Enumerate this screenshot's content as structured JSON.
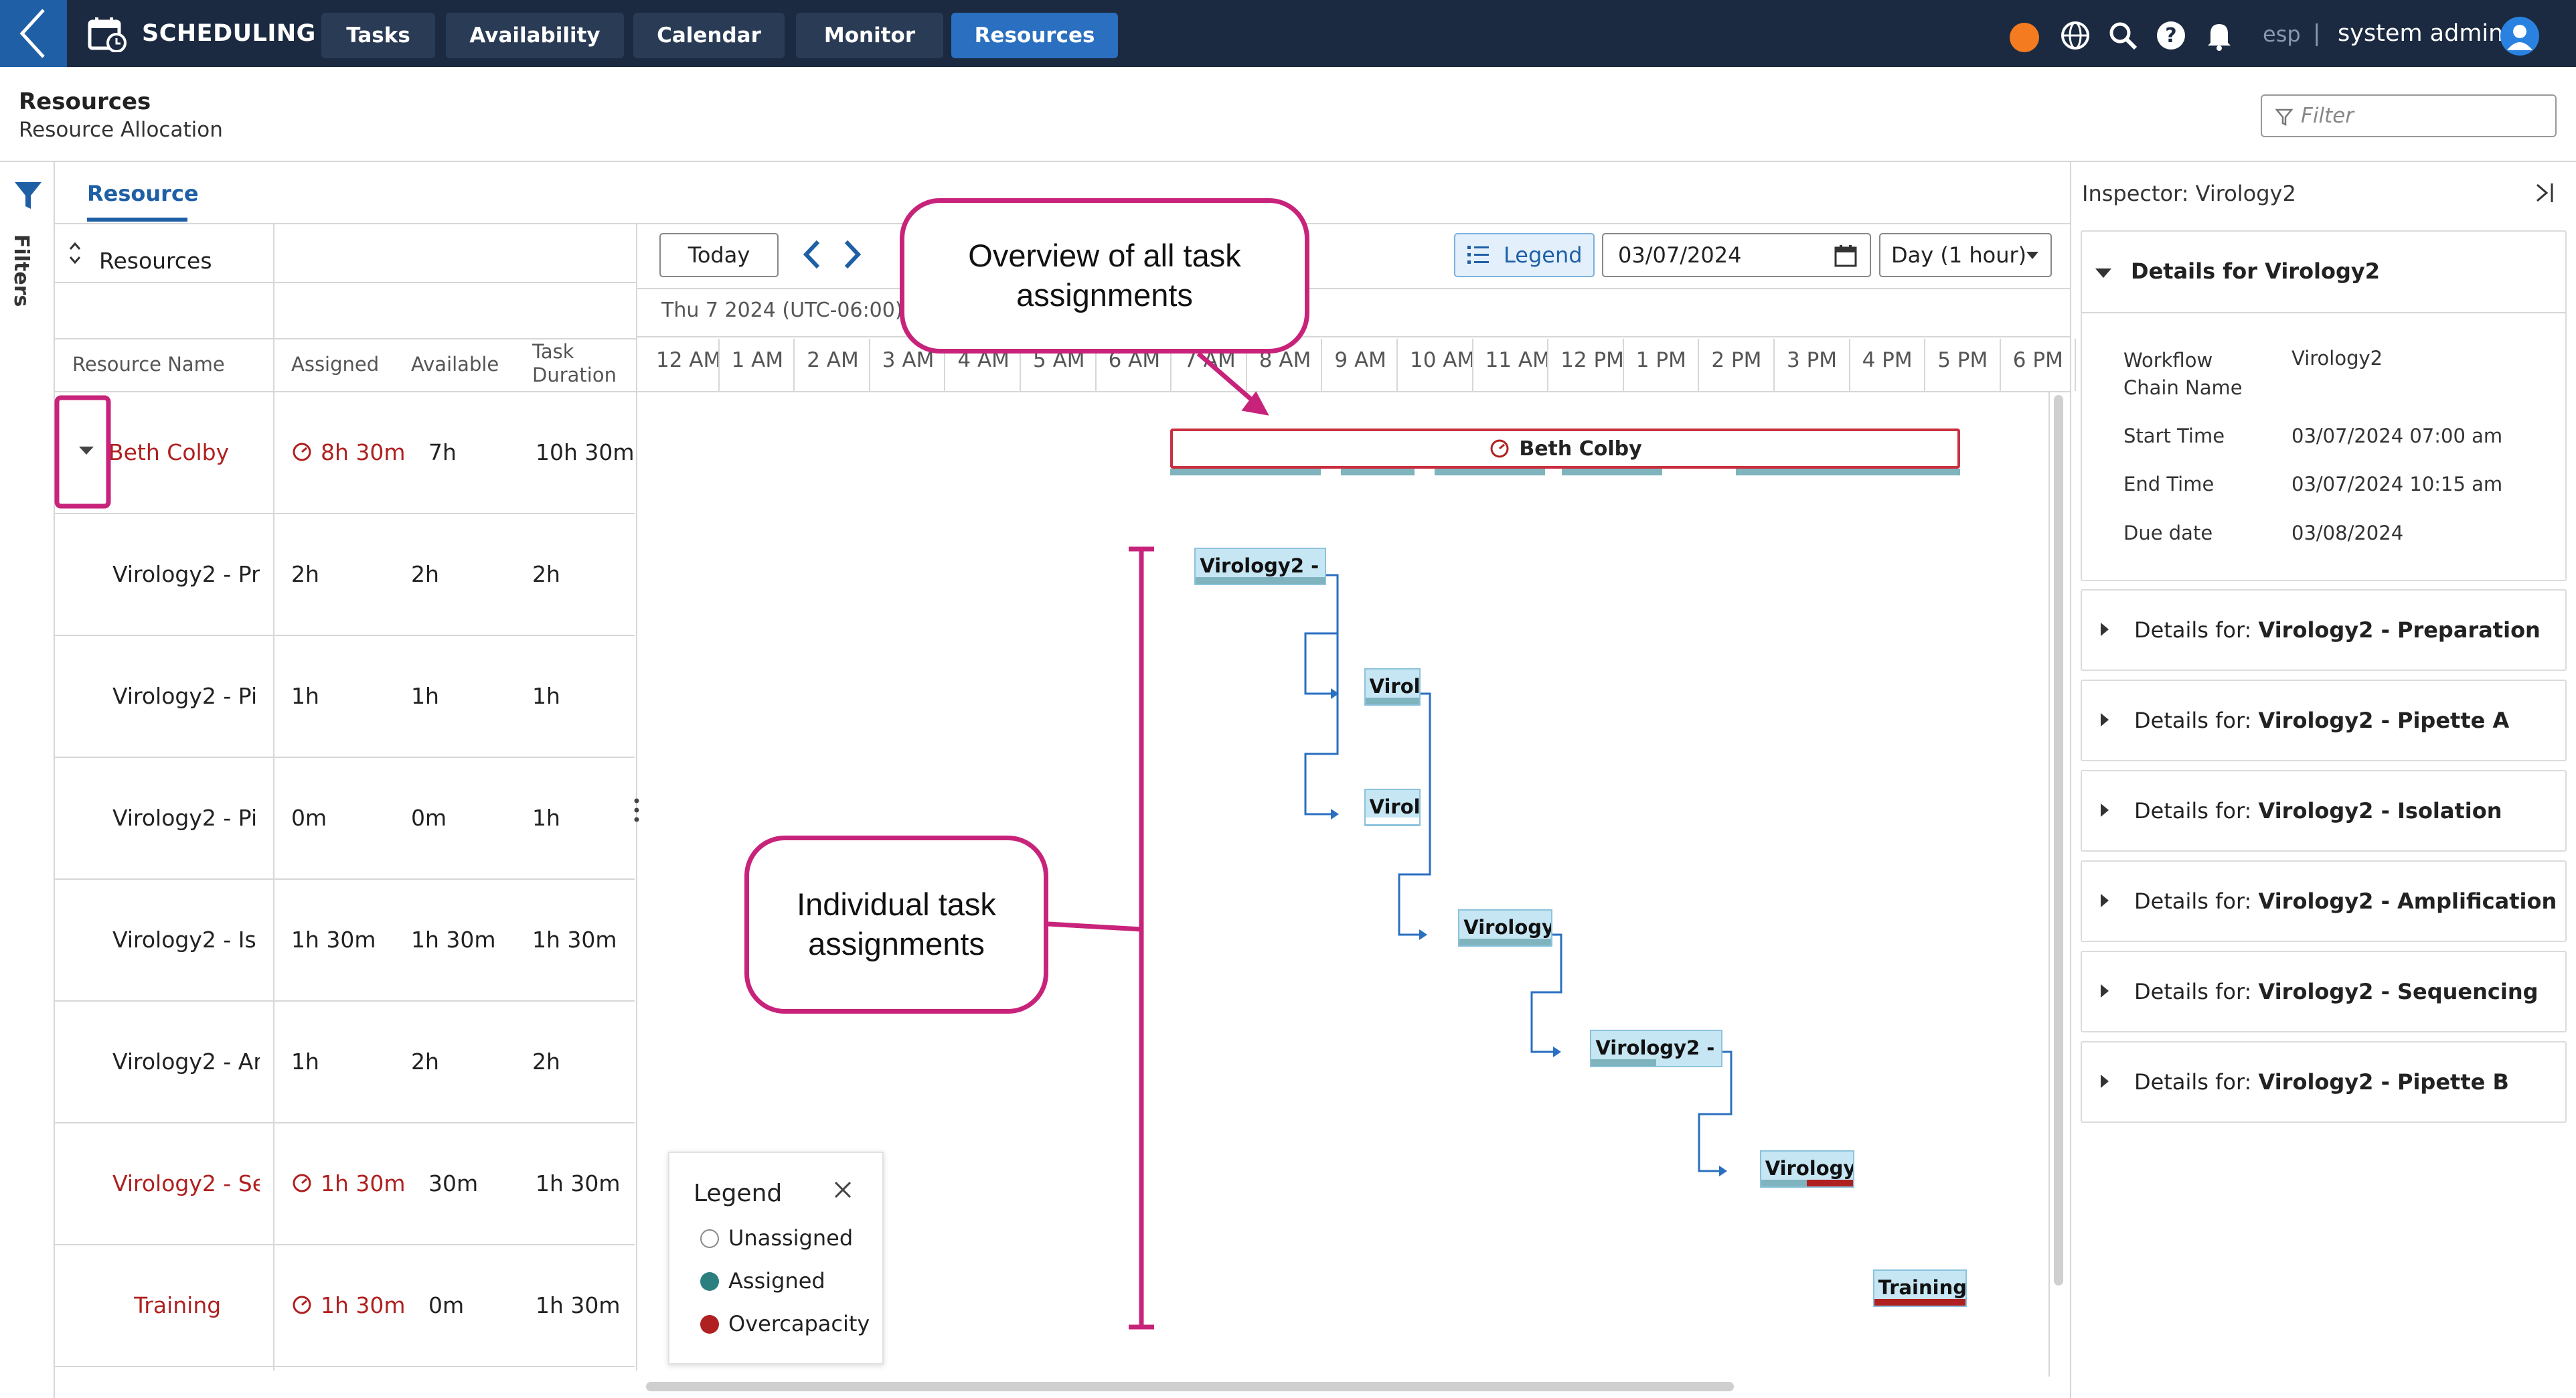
{
  "app": {
    "title": "SCHEDULING"
  },
  "nav": {
    "tabs": [
      "Tasks",
      "Availability",
      "Calendar",
      "Monitor",
      "Resources"
    ],
    "active": "Resources"
  },
  "topbar": {
    "lang": "esp",
    "user": "system admin"
  },
  "page": {
    "title": "Resources",
    "subtitle": "Resource Allocation",
    "filter_placeholder": "Filter"
  },
  "filters_label": "Filters",
  "resource_tab": "Resource",
  "table": {
    "group_header": "Resources",
    "columns": [
      "Resource Name",
      "Assigned",
      "Available",
      "Task\nDuration"
    ],
    "rows": [
      {
        "name": "Beth Colby",
        "assigned": "8h 30m",
        "available": "7h",
        "duration": "10h 30m",
        "over": true
      },
      {
        "name": "Virology2 - Pr",
        "assigned": "2h",
        "available": "2h",
        "duration": "2h",
        "over": false
      },
      {
        "name": "Virology2 - Pi",
        "assigned": "1h",
        "available": "1h",
        "duration": "1h",
        "over": false
      },
      {
        "name": "Virology2 - Pi",
        "assigned": "0m",
        "available": "0m",
        "duration": "1h",
        "over": false
      },
      {
        "name": "Virology2 - Is",
        "assigned": "1h 30m",
        "available": "1h 30m",
        "duration": "1h 30m",
        "over": false
      },
      {
        "name": "Virology2 - Ar",
        "assigned": "1h",
        "available": "2h",
        "duration": "2h",
        "over": false
      },
      {
        "name": "Virology2 - Se",
        "assigned": "1h 30m",
        "available": "30m",
        "duration": "1h 30m",
        "over": true
      },
      {
        "name": "Training",
        "assigned": "1h 30m",
        "available": "0m",
        "duration": "1h 30m",
        "over": true
      }
    ]
  },
  "gantt": {
    "today": "Today",
    "legend_button": "Legend",
    "date": "03/07/2024",
    "scale": "Day (1 hour)",
    "day_label": "Thu 7 2024 (UTC-06:00) C",
    "hours": [
      "12 AM",
      "1 AM",
      "2 AM",
      "3 AM",
      "4 AM",
      "5 AM",
      "6 AM",
      "7 AM",
      "8 AM",
      "9 AM",
      "10 AM",
      "11 AM",
      "12 PM",
      "1 PM",
      "2 PM",
      "3 PM",
      "4 PM",
      "5 PM",
      "6 PM"
    ],
    "summary": "Beth Colby",
    "tasks": [
      {
        "label": "Virology2 - Pr...",
        "start": 7.0,
        "end": 9.0,
        "fill": 1.0,
        "status": "assigned"
      },
      {
        "label": "Virol...",
        "start": 9.25,
        "end": 10.25,
        "fill": 1.0,
        "status": "assigned"
      },
      {
        "label": "Virol...",
        "start": 9.25,
        "end": 10.25,
        "fill": 0.0,
        "status": "unassigned"
      },
      {
        "label": "Virology2...",
        "start": 10.5,
        "end": 12.0,
        "fill": 1.0,
        "status": "assigned"
      },
      {
        "label": "Virology2 - A...",
        "start": 12.25,
        "end": 14.25,
        "fill": 0.5,
        "status": "assigned"
      },
      {
        "label": "Virology2...",
        "start": 14.5,
        "end": 16.0,
        "fill": 0.5,
        "status": "overcapacity"
      },
      {
        "label": "Training",
        "start": 16.0,
        "end": 17.5,
        "fill": 1.0,
        "status": "overcapacity"
      }
    ],
    "legend": {
      "title": "Legend",
      "items": [
        "Unassigned",
        "Assigned",
        "Overcapacity"
      ]
    },
    "colors": {
      "unassigned": "#ffffff",
      "assigned": "#2b7f7f",
      "overcapacity": "#b02020"
    }
  },
  "inspector": {
    "title": "Inspector: Virology2",
    "details_title": "Details for Virology2",
    "fields": [
      {
        "key": "Workflow\nChain Name",
        "value": "Virology2"
      },
      {
        "key": "Start Time",
        "value": "03/07/2024 07:00 am"
      },
      {
        "key": "End Time",
        "value": "03/07/2024 10:15 am"
      },
      {
        "key": "Due date",
        "value": "03/08/2024"
      }
    ],
    "sections": [
      {
        "prefix": "Details for: ",
        "name": "Virology2 - Preparation"
      },
      {
        "prefix": "Details for: ",
        "name": "Virology2 - Pipette A"
      },
      {
        "prefix": "Details for: ",
        "name": "Virology2 - Isolation"
      },
      {
        "prefix": "Details for: ",
        "name": "Virology2 - Amplification"
      },
      {
        "prefix": "Details for: ",
        "name": "Virology2 - Sequencing"
      },
      {
        "prefix": "Details for: ",
        "name": "Virology2 - Pipette B"
      }
    ]
  },
  "annotations": {
    "overview": "Overview of all task\nassignments",
    "individual": "Individual task\nassignments"
  }
}
